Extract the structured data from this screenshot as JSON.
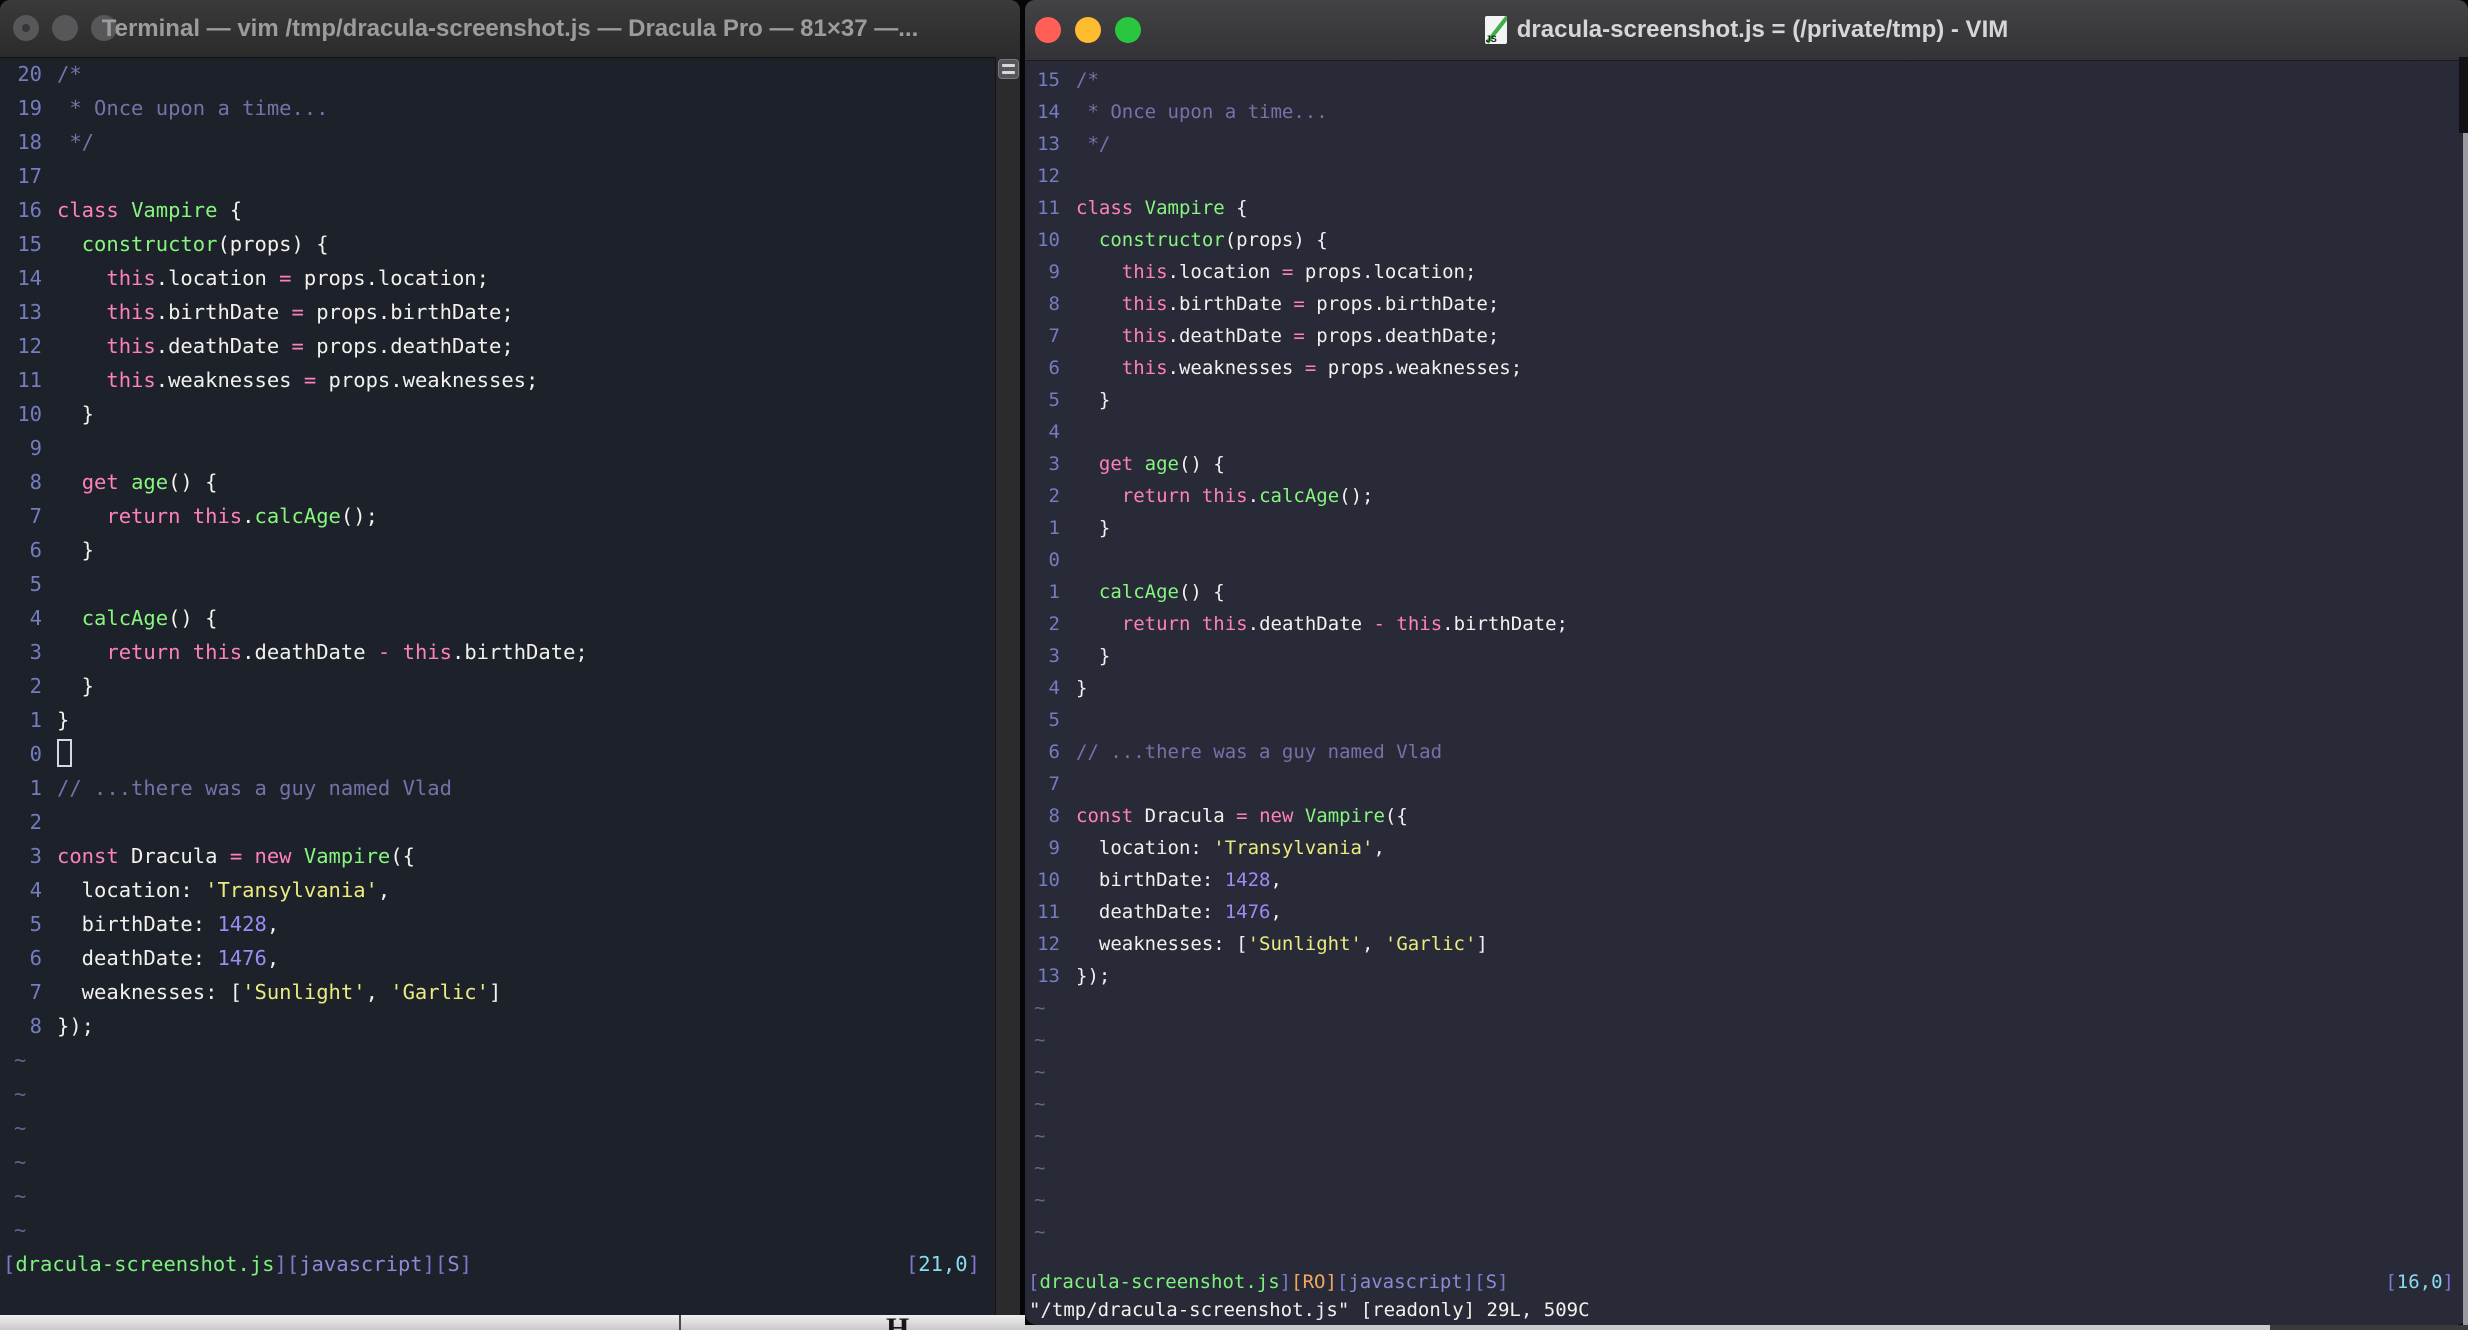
{
  "colors": {
    "f": "#f2f1ec",
    "c": "#7970a9",
    "p": "#ff80bf",
    "g": "#87f57f",
    "y": "#eceb80",
    "num": "#9a8cf2",
    "ln": "#757cc0",
    "tilde": "#606690",
    "sb": "#7d77ce",
    "sg": "#7ef27e",
    "sp": "#8e88d6",
    "so": "#f2a75f",
    "sc": "#86dcf0"
  },
  "tilde_char": "~",
  "left_window": {
    "title": "Terminal — vim /tmp/dracula-screenshot.js — Dracula Pro — 81×37 —...",
    "traffic_lights_state": "inactive-gray",
    "lines": [
      {
        "n": "20",
        "s": [
          [
            "c",
            "/*"
          ]
        ]
      },
      {
        "n": "19",
        "s": [
          [
            "c",
            " * Once upon a time..."
          ]
        ]
      },
      {
        "n": "18",
        "s": [
          [
            "c",
            " */"
          ]
        ]
      },
      {
        "n": "17",
        "s": []
      },
      {
        "n": "16",
        "s": [
          [
            "p",
            "class"
          ],
          [
            "f",
            " "
          ],
          [
            "g",
            "Vampire"
          ],
          [
            "f",
            " {"
          ]
        ]
      },
      {
        "n": "15",
        "s": [
          [
            "f",
            "  "
          ],
          [
            "g",
            "constructor"
          ],
          [
            "f",
            "(props) {"
          ]
        ]
      },
      {
        "n": "14",
        "s": [
          [
            "f",
            "    "
          ],
          [
            "p",
            "this"
          ],
          [
            "f",
            ".location "
          ],
          [
            "p",
            "="
          ],
          [
            "f",
            " props.location;"
          ]
        ]
      },
      {
        "n": "13",
        "s": [
          [
            "f",
            "    "
          ],
          [
            "p",
            "this"
          ],
          [
            "f",
            ".birthDate "
          ],
          [
            "p",
            "="
          ],
          [
            "f",
            " props.birthDate;"
          ]
        ]
      },
      {
        "n": "12",
        "s": [
          [
            "f",
            "    "
          ],
          [
            "p",
            "this"
          ],
          [
            "f",
            ".deathDate "
          ],
          [
            "p",
            "="
          ],
          [
            "f",
            " props.deathDate;"
          ]
        ]
      },
      {
        "n": "11",
        "s": [
          [
            "f",
            "    "
          ],
          [
            "p",
            "this"
          ],
          [
            "f",
            ".weaknesses "
          ],
          [
            "p",
            "="
          ],
          [
            "f",
            " props.weaknesses;"
          ]
        ]
      },
      {
        "n": "10",
        "s": [
          [
            "f",
            "  }"
          ]
        ]
      },
      {
        "n": "9",
        "s": []
      },
      {
        "n": "8",
        "s": [
          [
            "f",
            "  "
          ],
          [
            "p",
            "get"
          ],
          [
            "f",
            " "
          ],
          [
            "g",
            "age"
          ],
          [
            "f",
            "() {"
          ]
        ]
      },
      {
        "n": "7",
        "s": [
          [
            "f",
            "    "
          ],
          [
            "p",
            "return"
          ],
          [
            "f",
            " "
          ],
          [
            "p",
            "this"
          ],
          [
            "f",
            "."
          ],
          [
            "g",
            "calcAge"
          ],
          [
            "f",
            "();"
          ]
        ]
      },
      {
        "n": "6",
        "s": [
          [
            "f",
            "  }"
          ]
        ]
      },
      {
        "n": "5",
        "s": []
      },
      {
        "n": "4",
        "s": [
          [
            "f",
            "  "
          ],
          [
            "g",
            "calcAge"
          ],
          [
            "f",
            "() {"
          ]
        ]
      },
      {
        "n": "3",
        "s": [
          [
            "f",
            "    "
          ],
          [
            "p",
            "return"
          ],
          [
            "f",
            " "
          ],
          [
            "p",
            "this"
          ],
          [
            "f",
            ".deathDate "
          ],
          [
            "p",
            "-"
          ],
          [
            "f",
            " "
          ],
          [
            "p",
            "this"
          ],
          [
            "f",
            ".birthDate;"
          ]
        ]
      },
      {
        "n": "2",
        "s": [
          [
            "f",
            "  }"
          ]
        ]
      },
      {
        "n": "1",
        "s": [
          [
            "f",
            "}"
          ]
        ]
      },
      {
        "n": "0",
        "s": [],
        "cur": true
      },
      {
        "n": "1",
        "s": [
          [
            "c",
            "// ...there was a guy named Vlad"
          ]
        ]
      },
      {
        "n": "2",
        "s": []
      },
      {
        "n": "3",
        "s": [
          [
            "p",
            "const"
          ],
          [
            "f",
            " Dracula "
          ],
          [
            "p",
            "="
          ],
          [
            "f",
            " "
          ],
          [
            "p",
            "new"
          ],
          [
            "f",
            " "
          ],
          [
            "g",
            "Vampire"
          ],
          [
            "f",
            "({"
          ]
        ]
      },
      {
        "n": "4",
        "s": [
          [
            "f",
            "  location: "
          ],
          [
            "y",
            "'Transylvania'"
          ],
          [
            "f",
            ","
          ]
        ]
      },
      {
        "n": "5",
        "s": [
          [
            "f",
            "  birthDate: "
          ],
          [
            "num",
            "1428"
          ],
          [
            "f",
            ","
          ]
        ]
      },
      {
        "n": "6",
        "s": [
          [
            "f",
            "  deathDate: "
          ],
          [
            "num",
            "1476"
          ],
          [
            "f",
            ","
          ]
        ]
      },
      {
        "n": "7",
        "s": [
          [
            "f",
            "  weaknesses: ["
          ],
          [
            "y",
            "'Sunlight'"
          ],
          [
            "f",
            ", "
          ],
          [
            "y",
            "'Garlic'"
          ],
          [
            "f",
            "]"
          ]
        ]
      },
      {
        "n": "8",
        "s": [
          [
            "f",
            "});"
          ]
        ]
      }
    ],
    "tilde_count": 6,
    "status_left": [
      [
        "sb",
        "["
      ],
      [
        "sg",
        "dracula-screenshot.js"
      ],
      [
        "sb",
        "]["
      ],
      [
        "sp",
        "javascript"
      ],
      [
        "sb",
        "]["
      ],
      [
        "sp",
        "S"
      ],
      [
        "sb",
        "]"
      ]
    ],
    "status_right": [
      [
        "sb",
        "["
      ],
      [
        "sc",
        "21,0"
      ],
      [
        "sb",
        "]"
      ]
    ],
    "cmdline": ""
  },
  "right_window": {
    "title": "dracula-screenshot.js = (/private/tmp) - VIM",
    "proxy_icon": "js-document-icon",
    "traffic_lights_state": "active-colored",
    "lines": [
      {
        "n": "15",
        "s": [
          [
            "c",
            "/*"
          ]
        ]
      },
      {
        "n": "14",
        "s": [
          [
            "c",
            " * Once upon a time..."
          ]
        ]
      },
      {
        "n": "13",
        "s": [
          [
            "c",
            " */"
          ]
        ]
      },
      {
        "n": "12",
        "s": []
      },
      {
        "n": "11",
        "s": [
          [
            "p",
            "class"
          ],
          [
            "f",
            " "
          ],
          [
            "g",
            "Vampire"
          ],
          [
            "f",
            " {"
          ]
        ]
      },
      {
        "n": "10",
        "s": [
          [
            "f",
            "  "
          ],
          [
            "g",
            "constructor"
          ],
          [
            "f",
            "(props) {"
          ]
        ]
      },
      {
        "n": "9",
        "s": [
          [
            "f",
            "    "
          ],
          [
            "p",
            "this"
          ],
          [
            "f",
            ".location "
          ],
          [
            "p",
            "="
          ],
          [
            "f",
            " props.location;"
          ]
        ]
      },
      {
        "n": "8",
        "s": [
          [
            "f",
            "    "
          ],
          [
            "p",
            "this"
          ],
          [
            "f",
            ".birthDate "
          ],
          [
            "p",
            "="
          ],
          [
            "f",
            " props.birthDate;"
          ]
        ]
      },
      {
        "n": "7",
        "s": [
          [
            "f",
            "    "
          ],
          [
            "p",
            "this"
          ],
          [
            "f",
            ".deathDate "
          ],
          [
            "p",
            "="
          ],
          [
            "f",
            " props.deathDate;"
          ]
        ]
      },
      {
        "n": "6",
        "s": [
          [
            "f",
            "    "
          ],
          [
            "p",
            "this"
          ],
          [
            "f",
            ".weaknesses "
          ],
          [
            "p",
            "="
          ],
          [
            "f",
            " props.weaknesses;"
          ]
        ]
      },
      {
        "n": "5",
        "s": [
          [
            "f",
            "  }"
          ]
        ]
      },
      {
        "n": "4",
        "s": []
      },
      {
        "n": "3",
        "s": [
          [
            "f",
            "  "
          ],
          [
            "p",
            "get"
          ],
          [
            "f",
            " "
          ],
          [
            "g",
            "age"
          ],
          [
            "f",
            "() {"
          ]
        ]
      },
      {
        "n": "2",
        "s": [
          [
            "f",
            "    "
          ],
          [
            "p",
            "return"
          ],
          [
            "f",
            " "
          ],
          [
            "p",
            "this"
          ],
          [
            "f",
            "."
          ],
          [
            "g",
            "calcAge"
          ],
          [
            "f",
            "();"
          ]
        ]
      },
      {
        "n": "1",
        "s": [
          [
            "f",
            "  }"
          ]
        ]
      },
      {
        "n": "0",
        "s": []
      },
      {
        "n": "1",
        "s": [
          [
            "f",
            "  "
          ],
          [
            "g",
            "calcAge"
          ],
          [
            "f",
            "() {"
          ]
        ]
      },
      {
        "n": "2",
        "s": [
          [
            "f",
            "    "
          ],
          [
            "p",
            "return"
          ],
          [
            "f",
            " "
          ],
          [
            "p",
            "this"
          ],
          [
            "f",
            ".deathDate "
          ],
          [
            "p",
            "-"
          ],
          [
            "f",
            " "
          ],
          [
            "p",
            "this"
          ],
          [
            "f",
            ".birthDate;"
          ]
        ]
      },
      {
        "n": "3",
        "s": [
          [
            "f",
            "  }"
          ]
        ]
      },
      {
        "n": "4",
        "s": [
          [
            "f",
            "}"
          ]
        ]
      },
      {
        "n": "5",
        "s": []
      },
      {
        "n": "6",
        "s": [
          [
            "c",
            "// ...there was a guy named Vlad"
          ]
        ]
      },
      {
        "n": "7",
        "s": []
      },
      {
        "n": "8",
        "s": [
          [
            "p",
            "const"
          ],
          [
            "f",
            " Dracula "
          ],
          [
            "p",
            "="
          ],
          [
            "f",
            " "
          ],
          [
            "p",
            "new"
          ],
          [
            "f",
            " "
          ],
          [
            "g",
            "Vampire"
          ],
          [
            "f",
            "({"
          ]
        ]
      },
      {
        "n": "9",
        "s": [
          [
            "f",
            "  location: "
          ],
          [
            "y",
            "'Transylvania'"
          ],
          [
            "f",
            ","
          ]
        ]
      },
      {
        "n": "10",
        "s": [
          [
            "f",
            "  birthDate: "
          ],
          [
            "num",
            "1428"
          ],
          [
            "f",
            ","
          ]
        ]
      },
      {
        "n": "11",
        "s": [
          [
            "f",
            "  deathDate: "
          ],
          [
            "num",
            "1476"
          ],
          [
            "f",
            ","
          ]
        ]
      },
      {
        "n": "12",
        "s": [
          [
            "f",
            "  weaknesses: ["
          ],
          [
            "y",
            "'Sunlight'"
          ],
          [
            "f",
            ", "
          ],
          [
            "y",
            "'Garlic'"
          ],
          [
            "f",
            "]"
          ]
        ]
      },
      {
        "n": "13",
        "s": [
          [
            "f",
            "});"
          ]
        ]
      }
    ],
    "tilde_count": 8,
    "status_left": [
      [
        "sb",
        "["
      ],
      [
        "sg",
        "dracula-screenshot.js"
      ],
      [
        "sb",
        "]"
      ],
      [
        "so",
        "[RO]"
      ],
      [
        "sb",
        "["
      ],
      [
        "sp",
        "javascript"
      ],
      [
        "sb",
        "]["
      ],
      [
        "sp",
        "S"
      ],
      [
        "sb",
        "]"
      ]
    ],
    "status_right": [
      [
        "sb",
        "["
      ],
      [
        "sc",
        "16,0"
      ],
      [
        "sb",
        "]"
      ]
    ],
    "cmdline": "\"/tmp/dracula-screenshot.js\" [readonly] 29L, 509C"
  },
  "background": {
    "partial_glyph": "H"
  }
}
